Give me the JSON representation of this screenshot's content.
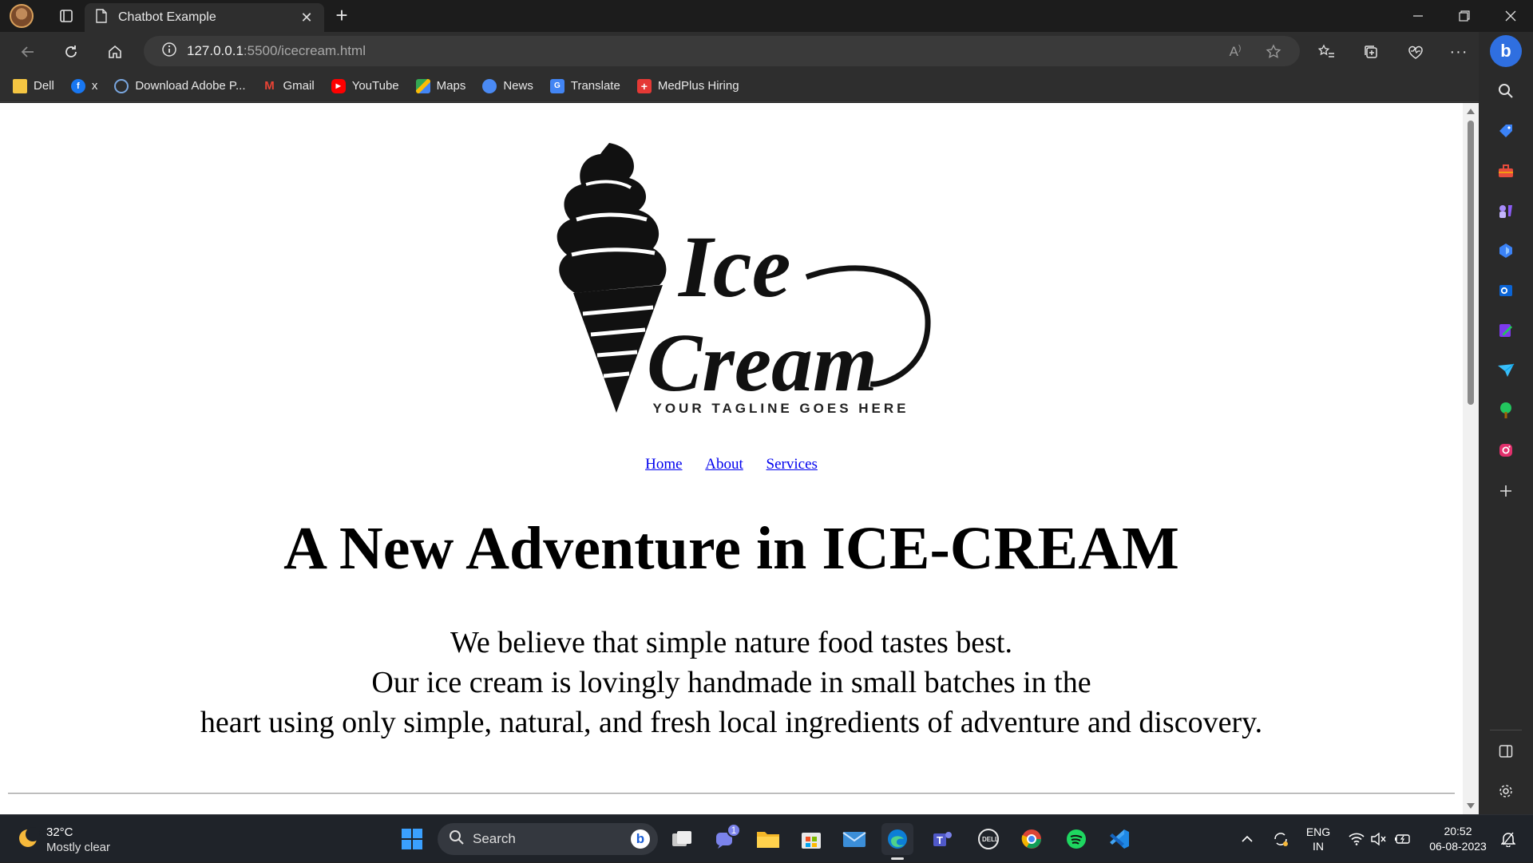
{
  "browser": {
    "tab_title": "Chatbot Example",
    "tab_close": "✕",
    "new_tab": "+",
    "url_host": "127.0.0.1",
    "url_path": ":5500/icecream.html"
  },
  "bookmarks": [
    {
      "label": "Dell",
      "icon": "folder-icon",
      "color": "#f4c542"
    },
    {
      "label": "x",
      "icon": "facebook-icon",
      "color": "#1877f2"
    },
    {
      "label": "Download Adobe P...",
      "icon": "adobe-icon",
      "color": "#7aa7e0"
    },
    {
      "label": "Gmail",
      "icon": "gmail-icon",
      "color": "#ea4335"
    },
    {
      "label": "YouTube",
      "icon": "youtube-icon",
      "color": "#ff0000"
    },
    {
      "label": "Maps",
      "icon": "maps-icon",
      "color": "#34a853"
    },
    {
      "label": "News",
      "icon": "news-icon",
      "color": "#4a8af4"
    },
    {
      "label": "Translate",
      "icon": "translate-icon",
      "color": "#4285f4"
    },
    {
      "label": "MedPlus Hiring",
      "icon": "medplus-icon",
      "color": "#e53935"
    }
  ],
  "page": {
    "logo": {
      "word1": "Ice",
      "word2": "Cream",
      "tagline": "YOUR TAGLINE GOES HERE"
    },
    "nav": [
      "Home",
      "About",
      "Services"
    ],
    "headline": "A New Adventure in ICE-CREAM",
    "paragraph": [
      "We believe that simple nature food tastes best.",
      "Our ice cream is lovingly handmade in small batches in the",
      "heart using only simple, natural, and fresh local ingredients of adventure and discovery."
    ]
  },
  "taskbar": {
    "weather_temp": "32°C",
    "weather_desc": "Mostly clear",
    "search_label": "Search",
    "teams_badge": "1",
    "lang_line1": "ENG",
    "lang_line2": "IN",
    "time": "20:52",
    "date": "06-08-2023"
  }
}
